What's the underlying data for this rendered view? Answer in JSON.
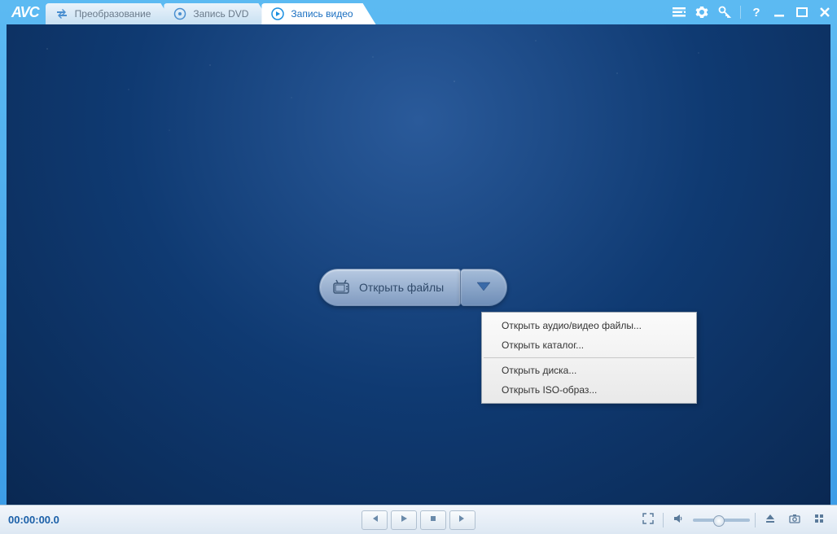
{
  "app": {
    "logo": "AVC"
  },
  "tabs": [
    {
      "label": "Преобразование",
      "active": false
    },
    {
      "label": "Запись DVD",
      "active": false
    },
    {
      "label": "Запись видео",
      "active": true
    }
  ],
  "main": {
    "open_button_label": "Открыть файлы",
    "dropdown": [
      "Открыть аудио/видео файлы...",
      "Открыть каталог...",
      "Открыть диска...",
      "Открыть ISO-образ..."
    ]
  },
  "bottom": {
    "timecode": "00:00:00.0"
  }
}
